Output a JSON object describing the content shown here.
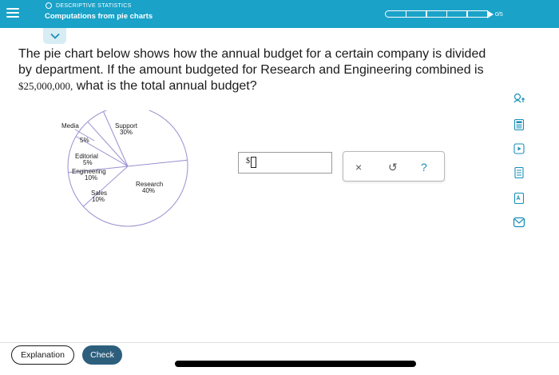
{
  "header": {
    "topic": "DESCRIPTIVE STATISTICS",
    "title": "Computations from pie charts",
    "progress_text": "0/5",
    "progress_fraction": 0,
    "accent_color": "#1aa2c8"
  },
  "question": {
    "text_before": "The pie chart below shows how the annual budget for a certain company is divided by department. If the amount budgeted for Research and Engineering combined is ",
    "amount": "$25,000,000,",
    "text_after": " what is the total annual budget?"
  },
  "chart_data": {
    "type": "pie",
    "title": "",
    "slices": [
      {
        "label": "Support",
        "value": 30,
        "percent_label": "30%"
      },
      {
        "label": "Research",
        "value": 40,
        "percent_label": "40%"
      },
      {
        "label": "Sales",
        "value": 10,
        "percent_label": "10%"
      },
      {
        "label": "Engineering",
        "value": 10,
        "percent_label": "10%"
      },
      {
        "label": "Editorial",
        "value": 5,
        "percent_label": "5%"
      },
      {
        "label": "Media",
        "value": 5,
        "percent_label": "5%"
      }
    ],
    "line_color": "#9a8fd0"
  },
  "answer": {
    "prefix": "$",
    "value": ""
  },
  "tools": {
    "clear_icon": "x-icon",
    "undo_icon": "undo-icon",
    "help_icon": "question-icon",
    "clear_glyph": "×",
    "undo_glyph": "↺",
    "help_glyph": "?"
  },
  "sidebar_icons": [
    "accessibility-icon",
    "calculator-icon",
    "video-icon",
    "textbook-icon",
    "glossary-icon",
    "message-icon"
  ],
  "buttons": {
    "explanation": "Explanation",
    "check": "Check",
    "check_color": "#2d5f7d"
  }
}
